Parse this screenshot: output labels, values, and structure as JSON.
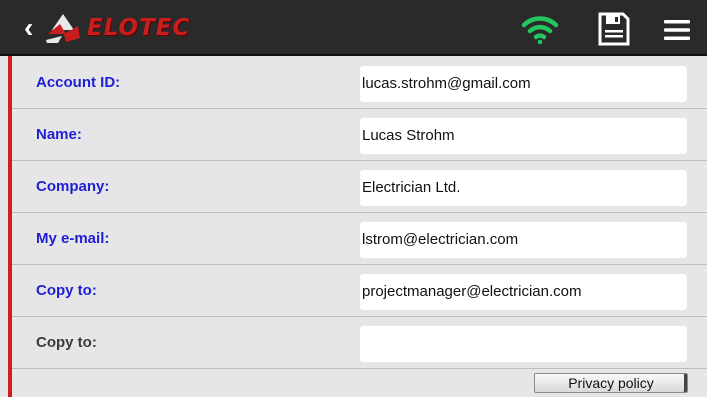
{
  "header": {
    "back_label": "‹",
    "brand": "ELOTEC",
    "icons": [
      "back-chevron-icon",
      "elotec-logo-icon",
      "wifi-icon",
      "save-disk-icon",
      "hamburger-menu-icon"
    ],
    "wifi_color": "#22c55e",
    "brand_color": "#c81e1e"
  },
  "form": {
    "rows": [
      {
        "label": "Account ID:",
        "value": "lucas.strohm@gmail.com"
      },
      {
        "label": "Name:",
        "value": "Lucas Strohm"
      },
      {
        "label": "Company:",
        "value": "Electrician Ltd."
      },
      {
        "label": "My e-mail:",
        "value": "lstrom@electrician.com"
      },
      {
        "label": "Copy to:",
        "value": "projectmanager@electrician.com"
      },
      {
        "label": "Copy to:",
        "value": ""
      }
    ]
  },
  "footer": {
    "privacy_label": "Privacy policy"
  },
  "colors": {
    "label_active": "#1f1fd6",
    "label_inactive": "#3a3a3a",
    "accent_strip": "#cc1f1f",
    "topbar": "#2a2a2a"
  }
}
